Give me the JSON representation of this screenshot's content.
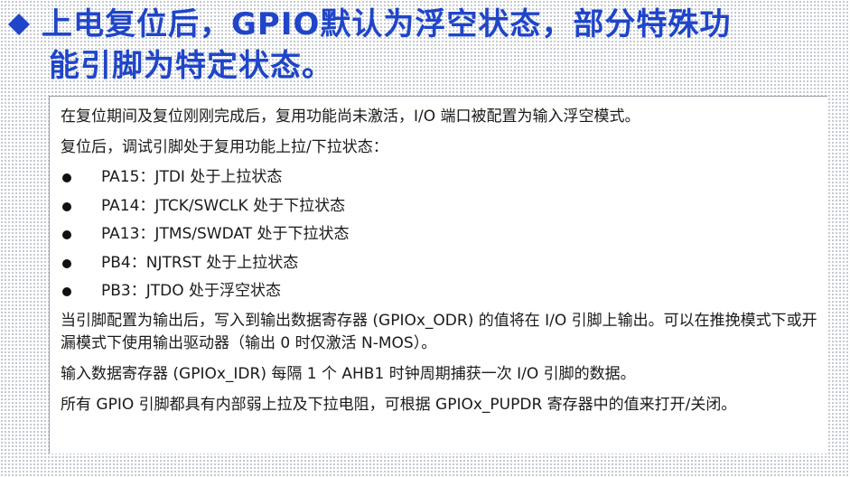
{
  "slide": {
    "title_line1": "上电复位后，GPIO默认为浮空状态，部分特殊功",
    "title_line2": "能引脚为特定状态。",
    "title_bullet_icon": "diamond-icon",
    "accent_color": "#1f45c8"
  },
  "document": {
    "intro": "在复位期间及复位刚刚完成后，复用功能尚未激活，I/O 端口被配置为输入浮空模式。",
    "after_reset": "复位后，调试引脚处于复用功能上拉/下拉状态：",
    "pins": [
      "PA15：JTDI 处于上拉状态",
      "PA14：JTCK/SWCLK 处于下拉状态",
      "PA13：JTMS/SWDAT 处于下拉状态",
      "PB4：NJTRST 处于上拉状态",
      "PB3：JTDO 处于浮空状态"
    ],
    "output_para": "当引脚配置为输出后，写入到输出数据寄存器 (GPIOx_ODR) 的值将在 I/O 引脚上输出。可以在推挽模式下或开漏模式下使用输出驱动器（输出 0 时仅激活 N-MOS）。",
    "input_para": "输入数据寄存器 (GPIOx_IDR) 每隔 1 个 AHB1 时钟周期捕获一次 I/O 引脚的数据。",
    "pull_para": "所有 GPIO 引脚都具有内部弱上拉及下拉电阻，可根据 GPIOx_PUPDR 寄存器中的值来打开/关闭。"
  }
}
